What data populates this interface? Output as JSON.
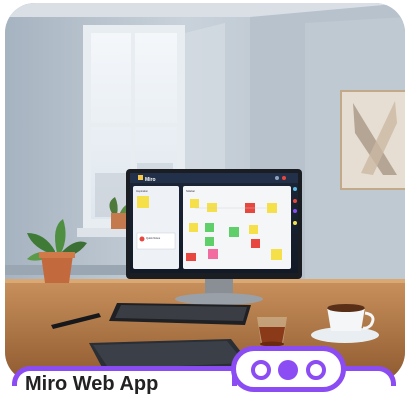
{
  "screen": {
    "app_name": "Miro",
    "sidebar_heading": "Inspiration",
    "sidebar_subheading": "Quick Notes",
    "board_heading": "Sidebar"
  },
  "caption": {
    "text": "Miro Web App"
  },
  "colors": {
    "accent": "#8b4cf3",
    "note_yellow": "#f6e04a",
    "note_green": "#5fcf6a",
    "note_red": "#e8473f",
    "note_pink": "#f26ca0"
  },
  "icons": [
    "window",
    "potted-plant",
    "monitor",
    "keyboard",
    "pen",
    "laptop",
    "tea-glass",
    "coffee-cup",
    "wall-art",
    "carousel-dots"
  ]
}
